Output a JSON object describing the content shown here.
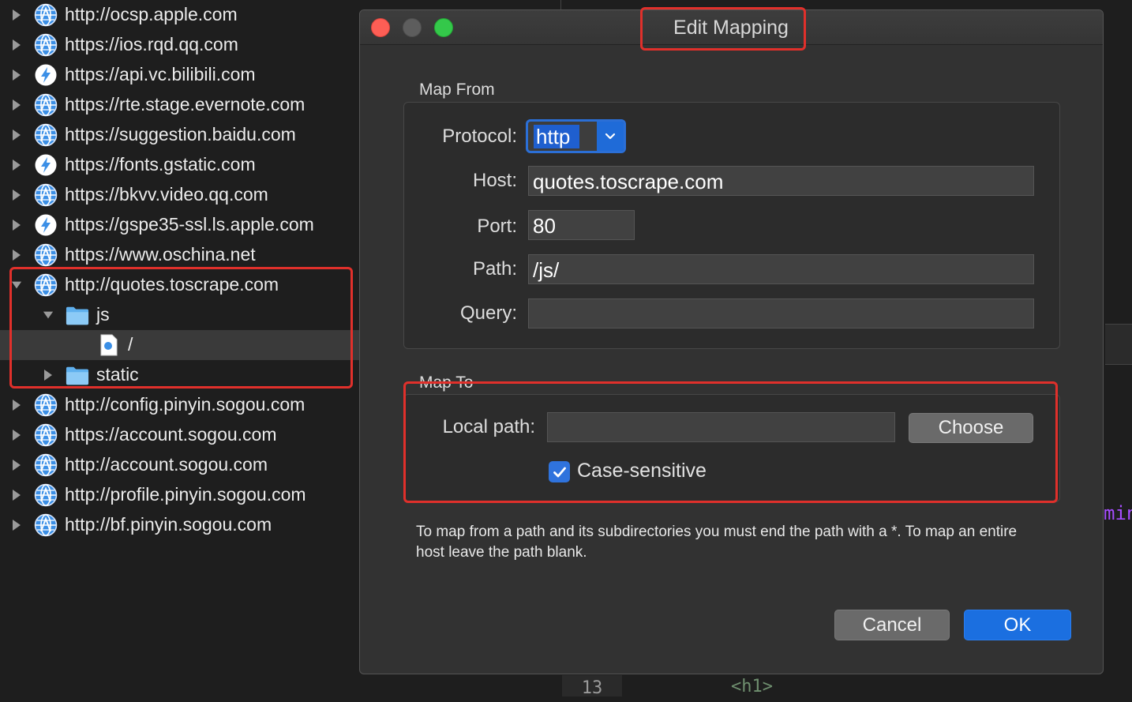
{
  "tree": {
    "rows": [
      {
        "label": "http://ocsp.apple.com",
        "icon": "globe-icon",
        "expanded": false
      },
      {
        "label": "https://ios.rqd.qq.com",
        "icon": "globe-icon",
        "expanded": false
      },
      {
        "label": "https://api.vc.bilibili.com",
        "icon": "lightning-icon",
        "expanded": false
      },
      {
        "label": "https://rte.stage.evernote.com",
        "icon": "globe-icon",
        "expanded": false
      },
      {
        "label": "https://suggestion.baidu.com",
        "icon": "globe-icon",
        "expanded": false
      },
      {
        "label": "https://fonts.gstatic.com",
        "icon": "lightning-icon",
        "expanded": false
      },
      {
        "label": "https://bkvv.video.qq.com",
        "icon": "globe-icon",
        "expanded": false
      },
      {
        "label": "https://gspe35-ssl.ls.apple.com",
        "icon": "lightning-icon",
        "expanded": false
      },
      {
        "label": "https://www.oschina.net",
        "icon": "globe-icon",
        "expanded": false
      },
      {
        "label": "http://quotes.toscrape.com",
        "icon": "globe-icon",
        "expanded": true
      },
      {
        "label": "js",
        "icon": "folder-icon",
        "expanded": true
      },
      {
        "label": "/",
        "icon": "file-icon",
        "selected": true
      },
      {
        "label": "static",
        "icon": "folder-icon",
        "expanded": false
      },
      {
        "label": "http://config.pinyin.sogou.com",
        "icon": "globe-icon",
        "expanded": false
      },
      {
        "label": "https://account.sogou.com",
        "icon": "globe-icon",
        "expanded": false
      },
      {
        "label": "http://account.sogou.com",
        "icon": "globe-icon",
        "expanded": false
      },
      {
        "label": "http://profile.pinyin.sogou.com",
        "icon": "globe-icon",
        "expanded": false
      },
      {
        "label": "http://bf.pinyin.sogou.com",
        "icon": "globe-icon",
        "expanded": false
      }
    ]
  },
  "background": {
    "line_number": "13",
    "code_snippet": "<h1>",
    "right_fragment": "min"
  },
  "dialog": {
    "title": "Edit Mapping",
    "map_from": {
      "group_label": "Map From",
      "protocol_label": "Protocol:",
      "protocol_value": "http",
      "host_label": "Host:",
      "host_value": "quotes.toscrape.com",
      "port_label": "Port:",
      "port_value": "80",
      "path_label": "Path:",
      "path_value": "/js/",
      "query_label": "Query:",
      "query_value": ""
    },
    "map_to": {
      "group_label": "Map To",
      "local_path_label": "Local path:",
      "local_path_value": "",
      "choose_label": "Choose",
      "case_sensitive_label": "Case-sensitive",
      "case_sensitive_checked": true
    },
    "help_text": "To map from a path and its subdirectories you must end the path with a *. To map an entire host leave the path blank.",
    "cancel_label": "Cancel",
    "ok_label": "OK"
  },
  "colors": {
    "annotation": "#e0302b",
    "accent": "#1b6fe0",
    "dialog_bg": "#323232",
    "panel_bg": "#1e1e1e"
  }
}
